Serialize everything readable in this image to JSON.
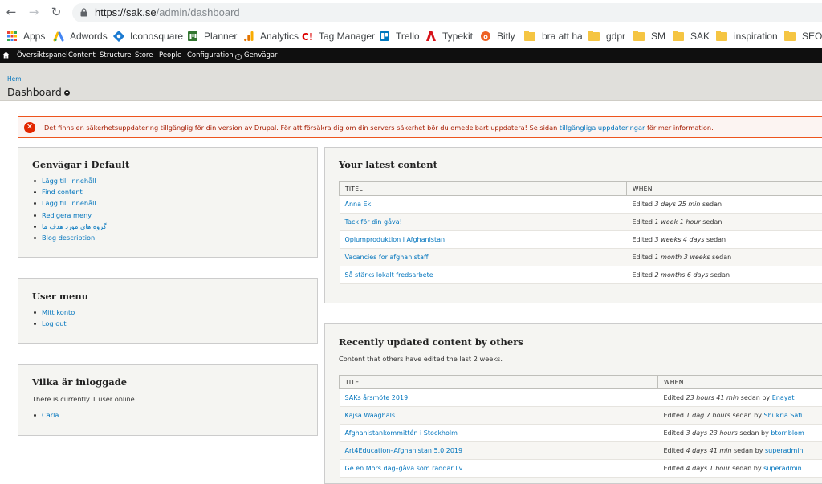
{
  "browser": {
    "url_host": "https://sak.se",
    "url_path": "/admin/dashboard",
    "bookmarks": [
      {
        "label": "Apps",
        "icon": "apps-grid-icon"
      },
      {
        "label": "Adwords",
        "icon": "adwords-icon"
      },
      {
        "label": "Iconosquare",
        "icon": "iconosquare-icon"
      },
      {
        "label": "Planner",
        "icon": "planner-icon"
      },
      {
        "label": "Analytics",
        "icon": "analytics-icon"
      },
      {
        "label": "Tag Manager",
        "icon": "tag-manager-icon"
      },
      {
        "label": "Trello",
        "icon": "trello-icon"
      },
      {
        "label": "Typekit",
        "icon": "typekit-icon"
      },
      {
        "label": "Bitly",
        "icon": "bitly-icon"
      },
      {
        "label": "bra att ha",
        "icon": "folder-icon"
      },
      {
        "label": "gdpr",
        "icon": "folder-icon"
      },
      {
        "label": "SM",
        "icon": "folder-icon"
      },
      {
        "label": "SAK",
        "icon": "folder-icon"
      },
      {
        "label": "inspiration",
        "icon": "folder-icon"
      },
      {
        "label": "SEO",
        "icon": "folder-icon"
      }
    ]
  },
  "toolbar": {
    "items": [
      "Översiktspanel",
      "Content",
      "Structure",
      "Store",
      "People",
      "Configuration"
    ],
    "shortcuts": "Genvägar"
  },
  "header": {
    "breadcrumb": "Hem",
    "title": "Dashboard"
  },
  "alert": {
    "text_before": "Det finns en säkerhetsuppdatering tillgänglig för din version av Drupal. För att försäkra dig om din servers säkerhet bör du omedelbart uppdatera! Se sidan ",
    "link": "tillgängliga uppdateringar",
    "text_after": " för mer information."
  },
  "shortcuts_panel": {
    "title": "Genvägar i Default",
    "links": [
      "Lägg till innehåll",
      "Find content",
      "Lägg till innehåll",
      "Redigera meny",
      "گروه های مورد هدف ما",
      "Blog description"
    ]
  },
  "user_menu": {
    "title": "User menu",
    "links": [
      "Mitt konto",
      "Log out"
    ]
  },
  "online": {
    "title": "Vilka är inloggade",
    "text": "There is currently 1 user online.",
    "users": [
      "Carla"
    ]
  },
  "latest": {
    "title": "Your latest content",
    "col_title": "TITEL",
    "col_when": "WHEN",
    "rows": [
      {
        "title": "Anna Ek",
        "pre": "Edited ",
        "time": "3 days 25 min",
        "post": " sedan"
      },
      {
        "title": "Tack för din gåva!",
        "pre": "Edited ",
        "time": "1 week 1 hour",
        "post": " sedan"
      },
      {
        "title": "Opiumproduktion i Afghanistan",
        "pre": "Edited ",
        "time": "3 weeks 4 days",
        "post": " sedan"
      },
      {
        "title": "Vacancies for afghan staff",
        "pre": "Edited ",
        "time": "1 month 3 weeks",
        "post": " sedan"
      },
      {
        "title": "Så stärks lokalt fredsarbete",
        "pre": "Edited ",
        "time": "2 months 6 days",
        "post": " sedan"
      }
    ]
  },
  "recent": {
    "title": "Recently updated content by others",
    "description": "Content that others have edited the last 2 weeks.",
    "col_title": "TITEL",
    "col_when": "WHEN",
    "rows": [
      {
        "title": "SAKs årsmöte 2019",
        "pre": "Edited ",
        "time": "23 hours 41 min",
        "post": " sedan by ",
        "user": "Enayat"
      },
      {
        "title": "Kajsa Waaghals",
        "pre": "Edited ",
        "time": "1 dag 7 hours",
        "post": " sedan by ",
        "user": "Shukria Safi"
      },
      {
        "title": "Afghanistankommittén i Stockholm",
        "pre": "Edited ",
        "time": "3 days 23 hours",
        "post": " sedan by ",
        "user": "btornblom"
      },
      {
        "title": "Art4Education–Afghanistan 5.0 2019",
        "pre": "Edited ",
        "time": "4 days 41 min",
        "post": " sedan by ",
        "user": "superadmin"
      },
      {
        "title": "Ge en Mors dag–gåva som räddar liv",
        "pre": "Edited ",
        "time": "4 days 1 hour",
        "post": " sedan by ",
        "user": "superadmin"
      }
    ]
  }
}
